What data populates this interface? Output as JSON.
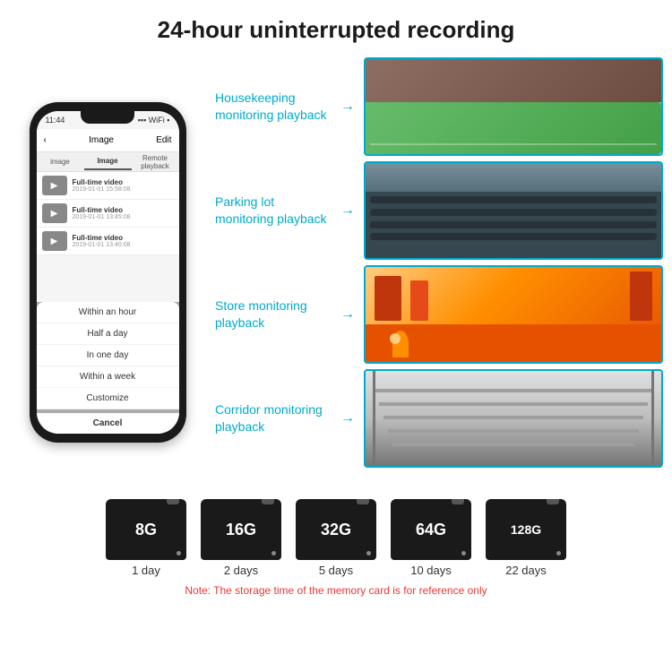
{
  "header": {
    "title": "24-hour uninterrupted recording"
  },
  "phone": {
    "time": "11:44",
    "screen_title": "Image",
    "screen_edit": "Edit",
    "tabs": [
      "image",
      "Image",
      "Remote playback"
    ],
    "videos": [
      {
        "title": "Full-time video",
        "date": "2019-01-01 15:58:08"
      },
      {
        "title": "Full-time video",
        "date": "2019-01-01 13:45:08"
      },
      {
        "title": "Full-time video",
        "date": "2019-01-01 13:40:08"
      }
    ],
    "dropdown_items": [
      "Within an hour",
      "Half a day",
      "In one day",
      "Within a week",
      "Customize"
    ],
    "cancel_label": "Cancel"
  },
  "monitoring": [
    {
      "label": "Housekeeping\nmonitoring playback",
      "scene": "housekeeping"
    },
    {
      "label": "Parking lot\nmonitoring playback",
      "scene": "parking"
    },
    {
      "label": "Store monitoring\nplayback",
      "scene": "store"
    },
    {
      "label": "Corridor monitoring\nplayback",
      "scene": "corridor"
    }
  ],
  "storage": {
    "cards": [
      {
        "size": "8G",
        "days": "1 day"
      },
      {
        "size": "16G",
        "days": "2 days"
      },
      {
        "size": "32G",
        "days": "5 days"
      },
      {
        "size": "64G",
        "days": "10 days"
      },
      {
        "size": "128G",
        "days": "22 days"
      }
    ],
    "note": "Note: The storage time of the memory card is for reference only"
  },
  "colors": {
    "accent": "#00aacc",
    "note_red": "#e53935",
    "dark": "#1a1a1a"
  }
}
